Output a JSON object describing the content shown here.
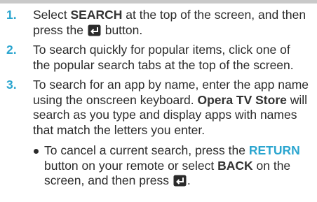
{
  "steps": [
    {
      "num": "1.",
      "parts": {
        "a": "Select ",
        "kw": "SEARCH",
        "b": " at the top of the screen, and then press the ",
        "icon": "enter-button-icon",
        "c": " button."
      }
    },
    {
      "num": "2.",
      "text": "To search quickly for popular items, click one of the popular search tabs at the top of the screen."
    },
    {
      "num": "3.",
      "parts": {
        "a": "To search for an app by name, enter the app name using the onscreen keyboard. ",
        "kw": "Opera TV Store",
        "b": " will search as you type and display apps with names that match the letters you enter."
      },
      "sub": {
        "a": "To cancel a current search, press the ",
        "kw1": "RETURN",
        "b": " button on your remote or select ",
        "kw2": "BACK",
        "c": " on the screen, and then press ",
        "icon": "enter-button-icon",
        "d": "."
      }
    }
  ],
  "colors": {
    "accent": "#2aa5cf",
    "text": "#2b2b2b",
    "rule": "#c9c9c9"
  }
}
